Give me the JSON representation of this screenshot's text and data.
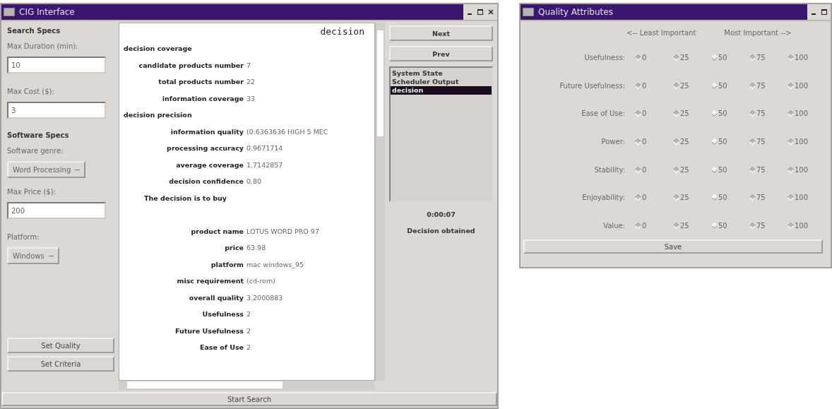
{
  "main_window": {
    "title": "CIG Interface",
    "search_panel": {
      "search_heading": "Search Specs",
      "max_duration": {
        "label": "Max Duration (min):",
        "value": "10"
      },
      "max_cost": {
        "label": "Max Cost ($):",
        "value": "3"
      },
      "software_heading": "Software Specs",
      "genre": {
        "label": "Software genre:",
        "value": "Word Processing"
      },
      "max_price": {
        "label": "Max Price ($):",
        "value": "200"
      },
      "platform": {
        "label": "Platform:",
        "value": "Windows"
      },
      "buttons": [
        "Set Quality",
        "Set Criteria"
      ]
    },
    "report": {
      "title": "decision",
      "rows": [
        {
          "kind": "section",
          "label": "decision coverage"
        },
        {
          "kind": "field",
          "label": "candidate products number",
          "value": "7"
        },
        {
          "kind": "field",
          "label": "total products number",
          "value": "22"
        },
        {
          "kind": "field",
          "label": "information coverage",
          "value": "33"
        },
        {
          "kind": "section",
          "label": "decision precision"
        },
        {
          "kind": "field",
          "label": "information quality",
          "value": "(0.6363636 HIGH 5 MEC"
        },
        {
          "kind": "field",
          "label": "processing accuracy",
          "value": "0.9671714"
        },
        {
          "kind": "field",
          "label": "average coverage",
          "value": "1.7142857"
        },
        {
          "kind": "field",
          "label": "decision confidence",
          "value": "0.80"
        },
        {
          "kind": "note",
          "label": "The decision is to buy"
        },
        {
          "kind": "blank"
        },
        {
          "kind": "field",
          "label": "product name",
          "value": "LOTUS WORD PRO 97"
        },
        {
          "kind": "field",
          "label": "price",
          "value": "63.98"
        },
        {
          "kind": "field",
          "label": "platform",
          "value": "mac windows_95"
        },
        {
          "kind": "field",
          "label": "misc requirement",
          "value": "(cd-rom)"
        },
        {
          "kind": "field",
          "label": "overall quality",
          "value": "3.2000883"
        },
        {
          "kind": "field",
          "label": "Usefulness",
          "value": "2"
        },
        {
          "kind": "field",
          "label": "Future Usefulness",
          "value": "2"
        },
        {
          "kind": "field",
          "label": "Ease of Use",
          "value": "2"
        }
      ]
    },
    "nav_buttons": [
      "Next",
      "Prev"
    ],
    "views": [
      {
        "label": "System State",
        "selected": false
      },
      {
        "label": "Scheduler Output",
        "selected": false
      },
      {
        "label": "decision",
        "selected": true
      }
    ],
    "elapsed": "0:00:07",
    "status": "Decision obtained",
    "start_button": "Start Search"
  },
  "quality_window": {
    "title": "Quality Attributes",
    "least": "<-- Least Important",
    "most": "Most Important -->",
    "attributes": [
      {
        "label": "Usefulness:",
        "options": [
          {
            "label": "0",
            "selected": false
          },
          {
            "label": "25",
            "selected": false
          },
          {
            "label": "50",
            "selected": true
          },
          {
            "label": "75",
            "selected": false
          },
          {
            "label": "100",
            "selected": false
          }
        ]
      },
      {
        "label": "Future Usefulness:",
        "options": [
          {
            "label": "0",
            "selected": false
          },
          {
            "label": "25",
            "selected": false
          },
          {
            "label": "50",
            "selected": true
          },
          {
            "label": "75",
            "selected": false
          },
          {
            "label": "100",
            "selected": false
          }
        ]
      },
      {
        "label": "Ease of Use:",
        "options": [
          {
            "label": "0",
            "selected": false
          },
          {
            "label": "25",
            "selected": false
          },
          {
            "label": "50",
            "selected": true
          },
          {
            "label": "75",
            "selected": false
          },
          {
            "label": "100",
            "selected": false
          }
        ]
      },
      {
        "label": "Power:",
        "options": [
          {
            "label": "0",
            "selected": false
          },
          {
            "label": "25",
            "selected": false
          },
          {
            "label": "50",
            "selected": true
          },
          {
            "label": "75",
            "selected": false
          },
          {
            "label": "100",
            "selected": false
          }
        ]
      },
      {
        "label": "Stability:",
        "options": [
          {
            "label": "0",
            "selected": false
          },
          {
            "label": "25",
            "selected": false
          },
          {
            "label": "50",
            "selected": true
          },
          {
            "label": "75",
            "selected": false
          },
          {
            "label": "100",
            "selected": false
          }
        ]
      },
      {
        "label": "Enjoyability:",
        "options": [
          {
            "label": "0",
            "selected": false
          },
          {
            "label": "25",
            "selected": false
          },
          {
            "label": "50",
            "selected": true
          },
          {
            "label": "75",
            "selected": false
          },
          {
            "label": "100",
            "selected": false
          }
        ]
      },
      {
        "label": "Value:",
        "options": [
          {
            "label": "0",
            "selected": false
          },
          {
            "label": "25",
            "selected": false
          },
          {
            "label": "50",
            "selected": true
          },
          {
            "label": "75",
            "selected": false
          },
          {
            "label": "100",
            "selected": false
          }
        ]
      }
    ],
    "save_button": "Save"
  }
}
